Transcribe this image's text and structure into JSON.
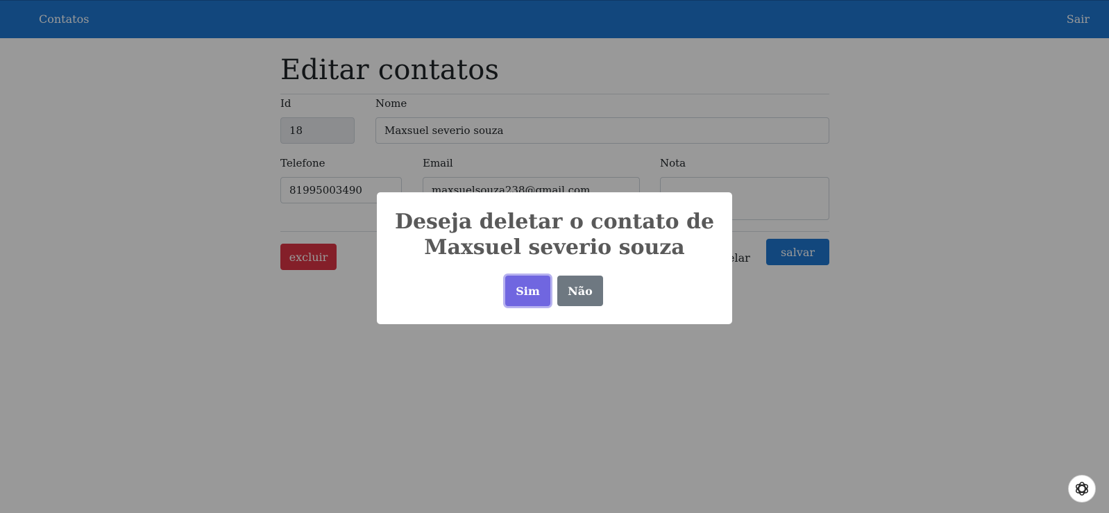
{
  "navbar": {
    "brand": "Contatos",
    "exit_label": "Sair",
    "color": "#1f77d0"
  },
  "page": {
    "title": "Editar contatos"
  },
  "form": {
    "id": {
      "label": "Id",
      "value": "18"
    },
    "name": {
      "label": "Nome",
      "value": "Maxsuel severio souza"
    },
    "phone": {
      "label": "Telefone",
      "value": "81995003490"
    },
    "email": {
      "label": "Email",
      "value": "maxsuelsouza238@gmail.com"
    },
    "note": {
      "label": "Nota",
      "value": ""
    }
  },
  "actions": {
    "delete_label": "excluir",
    "cancel_label": "cancelar",
    "save_label": "salvar"
  },
  "dialog": {
    "title": "Deseja deletar o contato de Maxsuel severio souza",
    "confirm_label": "Sim",
    "deny_label": "Não",
    "confirm_color": "#7066e0",
    "deny_color": "#6e7881"
  },
  "badge": {
    "icon": "openai-logo-icon"
  }
}
